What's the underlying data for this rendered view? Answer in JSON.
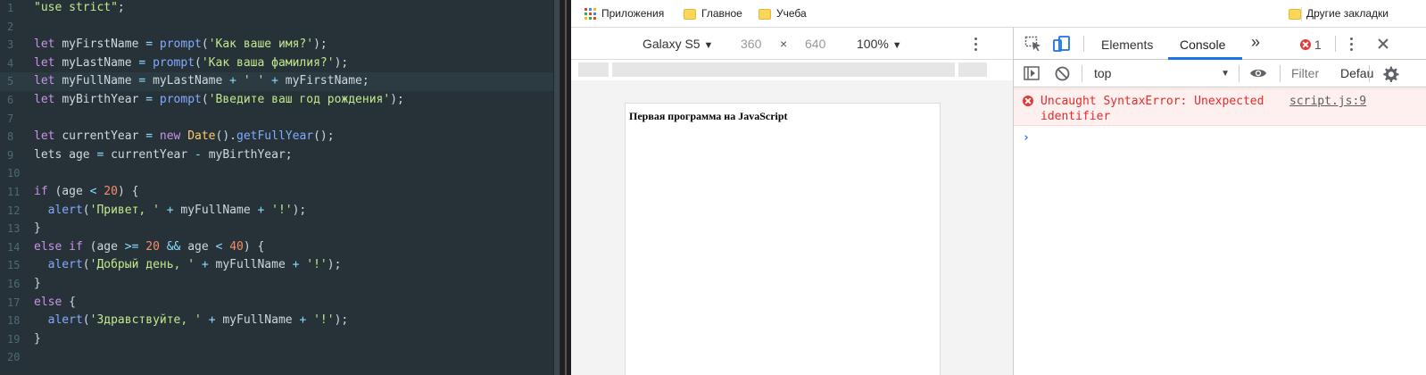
{
  "editor": {
    "lines": [
      {
        "n": "1",
        "tokens": [
          {
            "t": "\"use strict\"",
            "c": "str"
          },
          {
            "t": ";",
            "c": "plain"
          }
        ]
      },
      {
        "n": "2",
        "tokens": []
      },
      {
        "n": "3",
        "tokens": [
          {
            "t": "let ",
            "c": "kw"
          },
          {
            "t": "myFirstName ",
            "c": "plain"
          },
          {
            "t": "= ",
            "c": "op"
          },
          {
            "t": "prompt",
            "c": "fn"
          },
          {
            "t": "(",
            "c": "plain"
          },
          {
            "t": "'Как ваше имя?'",
            "c": "str"
          },
          {
            "t": ");",
            "c": "plain"
          }
        ]
      },
      {
        "n": "4",
        "tokens": [
          {
            "t": "let ",
            "c": "kw"
          },
          {
            "t": "myLastName ",
            "c": "plain"
          },
          {
            "t": "= ",
            "c": "op"
          },
          {
            "t": "prompt",
            "c": "fn"
          },
          {
            "t": "(",
            "c": "plain"
          },
          {
            "t": "'Как ваша фамилия?'",
            "c": "str"
          },
          {
            "t": ");",
            "c": "plain"
          }
        ]
      },
      {
        "n": "5",
        "tokens": [
          {
            "t": "let ",
            "c": "kw"
          },
          {
            "t": "myFullName ",
            "c": "plain"
          },
          {
            "t": "= ",
            "c": "op"
          },
          {
            "t": "myLastName ",
            "c": "plain"
          },
          {
            "t": "+ ",
            "c": "op"
          },
          {
            "t": "' ' ",
            "c": "str"
          },
          {
            "t": "+ ",
            "c": "op"
          },
          {
            "t": "myFirstName",
            "c": "plain"
          },
          {
            "t": ";",
            "c": "plain"
          }
        ],
        "active": true
      },
      {
        "n": "6",
        "tokens": [
          {
            "t": "let ",
            "c": "kw"
          },
          {
            "t": "myBirthYear ",
            "c": "plain"
          },
          {
            "t": "= ",
            "c": "op"
          },
          {
            "t": "prompt",
            "c": "fn"
          },
          {
            "t": "(",
            "c": "plain"
          },
          {
            "t": "'Введите ваш год рождения'",
            "c": "str"
          },
          {
            "t": ");",
            "c": "plain"
          }
        ]
      },
      {
        "n": "7",
        "tokens": []
      },
      {
        "n": "8",
        "tokens": [
          {
            "t": "let ",
            "c": "kw"
          },
          {
            "t": "currentYear ",
            "c": "plain"
          },
          {
            "t": "= ",
            "c": "op"
          },
          {
            "t": "new ",
            "c": "kw"
          },
          {
            "t": "Date",
            "c": "cls"
          },
          {
            "t": "().",
            "c": "plain"
          },
          {
            "t": "getFullYear",
            "c": "fn"
          },
          {
            "t": "();",
            "c": "plain"
          }
        ]
      },
      {
        "n": "9",
        "tokens": [
          {
            "t": "lets age ",
            "c": "plain"
          },
          {
            "t": "= ",
            "c": "op"
          },
          {
            "t": "currentYear ",
            "c": "plain"
          },
          {
            "t": "- ",
            "c": "op"
          },
          {
            "t": "myBirthYear",
            "c": "plain"
          },
          {
            "t": ";",
            "c": "plain"
          }
        ]
      },
      {
        "n": "10",
        "tokens": []
      },
      {
        "n": "11",
        "tokens": [
          {
            "t": "if ",
            "c": "kw"
          },
          {
            "t": "(age ",
            "c": "plain"
          },
          {
            "t": "< ",
            "c": "op"
          },
          {
            "t": "20",
            "c": "num"
          },
          {
            "t": ") {",
            "c": "plain"
          }
        ]
      },
      {
        "n": "12",
        "tokens": [
          {
            "t": "  ",
            "c": "plain"
          },
          {
            "t": "alert",
            "c": "fn"
          },
          {
            "t": "(",
            "c": "plain"
          },
          {
            "t": "'Привет, ' ",
            "c": "str"
          },
          {
            "t": "+ ",
            "c": "op"
          },
          {
            "t": "myFullName ",
            "c": "plain"
          },
          {
            "t": "+ ",
            "c": "op"
          },
          {
            "t": "'!'",
            "c": "str"
          },
          {
            "t": ");",
            "c": "plain"
          }
        ]
      },
      {
        "n": "13",
        "tokens": [
          {
            "t": "}",
            "c": "plain"
          }
        ]
      },
      {
        "n": "14",
        "tokens": [
          {
            "t": "else if ",
            "c": "kw"
          },
          {
            "t": "(age ",
            "c": "plain"
          },
          {
            "t": ">= ",
            "c": "op"
          },
          {
            "t": "20 ",
            "c": "num"
          },
          {
            "t": "&& ",
            "c": "op"
          },
          {
            "t": "age ",
            "c": "plain"
          },
          {
            "t": "< ",
            "c": "op"
          },
          {
            "t": "40",
            "c": "num"
          },
          {
            "t": ") {",
            "c": "plain"
          }
        ]
      },
      {
        "n": "15",
        "tokens": [
          {
            "t": "  ",
            "c": "plain"
          },
          {
            "t": "alert",
            "c": "fn"
          },
          {
            "t": "(",
            "c": "plain"
          },
          {
            "t": "'Добрый день, ' ",
            "c": "str"
          },
          {
            "t": "+ ",
            "c": "op"
          },
          {
            "t": "myFullName ",
            "c": "plain"
          },
          {
            "t": "+ ",
            "c": "op"
          },
          {
            "t": "'!'",
            "c": "str"
          },
          {
            "t": ");",
            "c": "plain"
          }
        ]
      },
      {
        "n": "16",
        "tokens": [
          {
            "t": "}",
            "c": "plain"
          }
        ]
      },
      {
        "n": "17",
        "tokens": [
          {
            "t": "else ",
            "c": "kw"
          },
          {
            "t": "{",
            "c": "plain"
          }
        ]
      },
      {
        "n": "18",
        "tokens": [
          {
            "t": "  ",
            "c": "plain"
          },
          {
            "t": "alert",
            "c": "fn"
          },
          {
            "t": "(",
            "c": "plain"
          },
          {
            "t": "'Здравствуйте, ' ",
            "c": "str"
          },
          {
            "t": "+ ",
            "c": "op"
          },
          {
            "t": "myFullName ",
            "c": "plain"
          },
          {
            "t": "+ ",
            "c": "op"
          },
          {
            "t": "'!'",
            "c": "str"
          },
          {
            "t": ");",
            "c": "plain"
          }
        ]
      },
      {
        "n": "19",
        "tokens": [
          {
            "t": "}",
            "c": "plain"
          }
        ]
      },
      {
        "n": "20",
        "tokens": []
      }
    ]
  },
  "bookmarks": {
    "apps_label": "Приложения",
    "items": [
      "Главное",
      "Учеба"
    ],
    "other_label": "Другие закладки"
  },
  "device_toolbar": {
    "device": "Galaxy S5",
    "width": "360",
    "times": "×",
    "height": "640",
    "zoom": "100%"
  },
  "page": {
    "text": "Первая программа на JavaScript"
  },
  "devtools": {
    "tabs": [
      "Elements",
      "Console"
    ],
    "active_tab": "Console",
    "more_tabs": "»",
    "error_count": "1",
    "context": "top",
    "filter_placeholder": "Filter",
    "levels": "Defau",
    "error": {
      "message": "Uncaught SyntaxError: Unexpected identifier",
      "source": "script.js:9"
    },
    "prompt_symbol": "›"
  },
  "colors": {
    "editor_bg": "#263238",
    "keyword": "#c792ea",
    "function": "#82aaff",
    "string": "#c3e88d",
    "number": "#f78c6c",
    "error": "#e42a2a",
    "accent": "#1a73e8"
  }
}
